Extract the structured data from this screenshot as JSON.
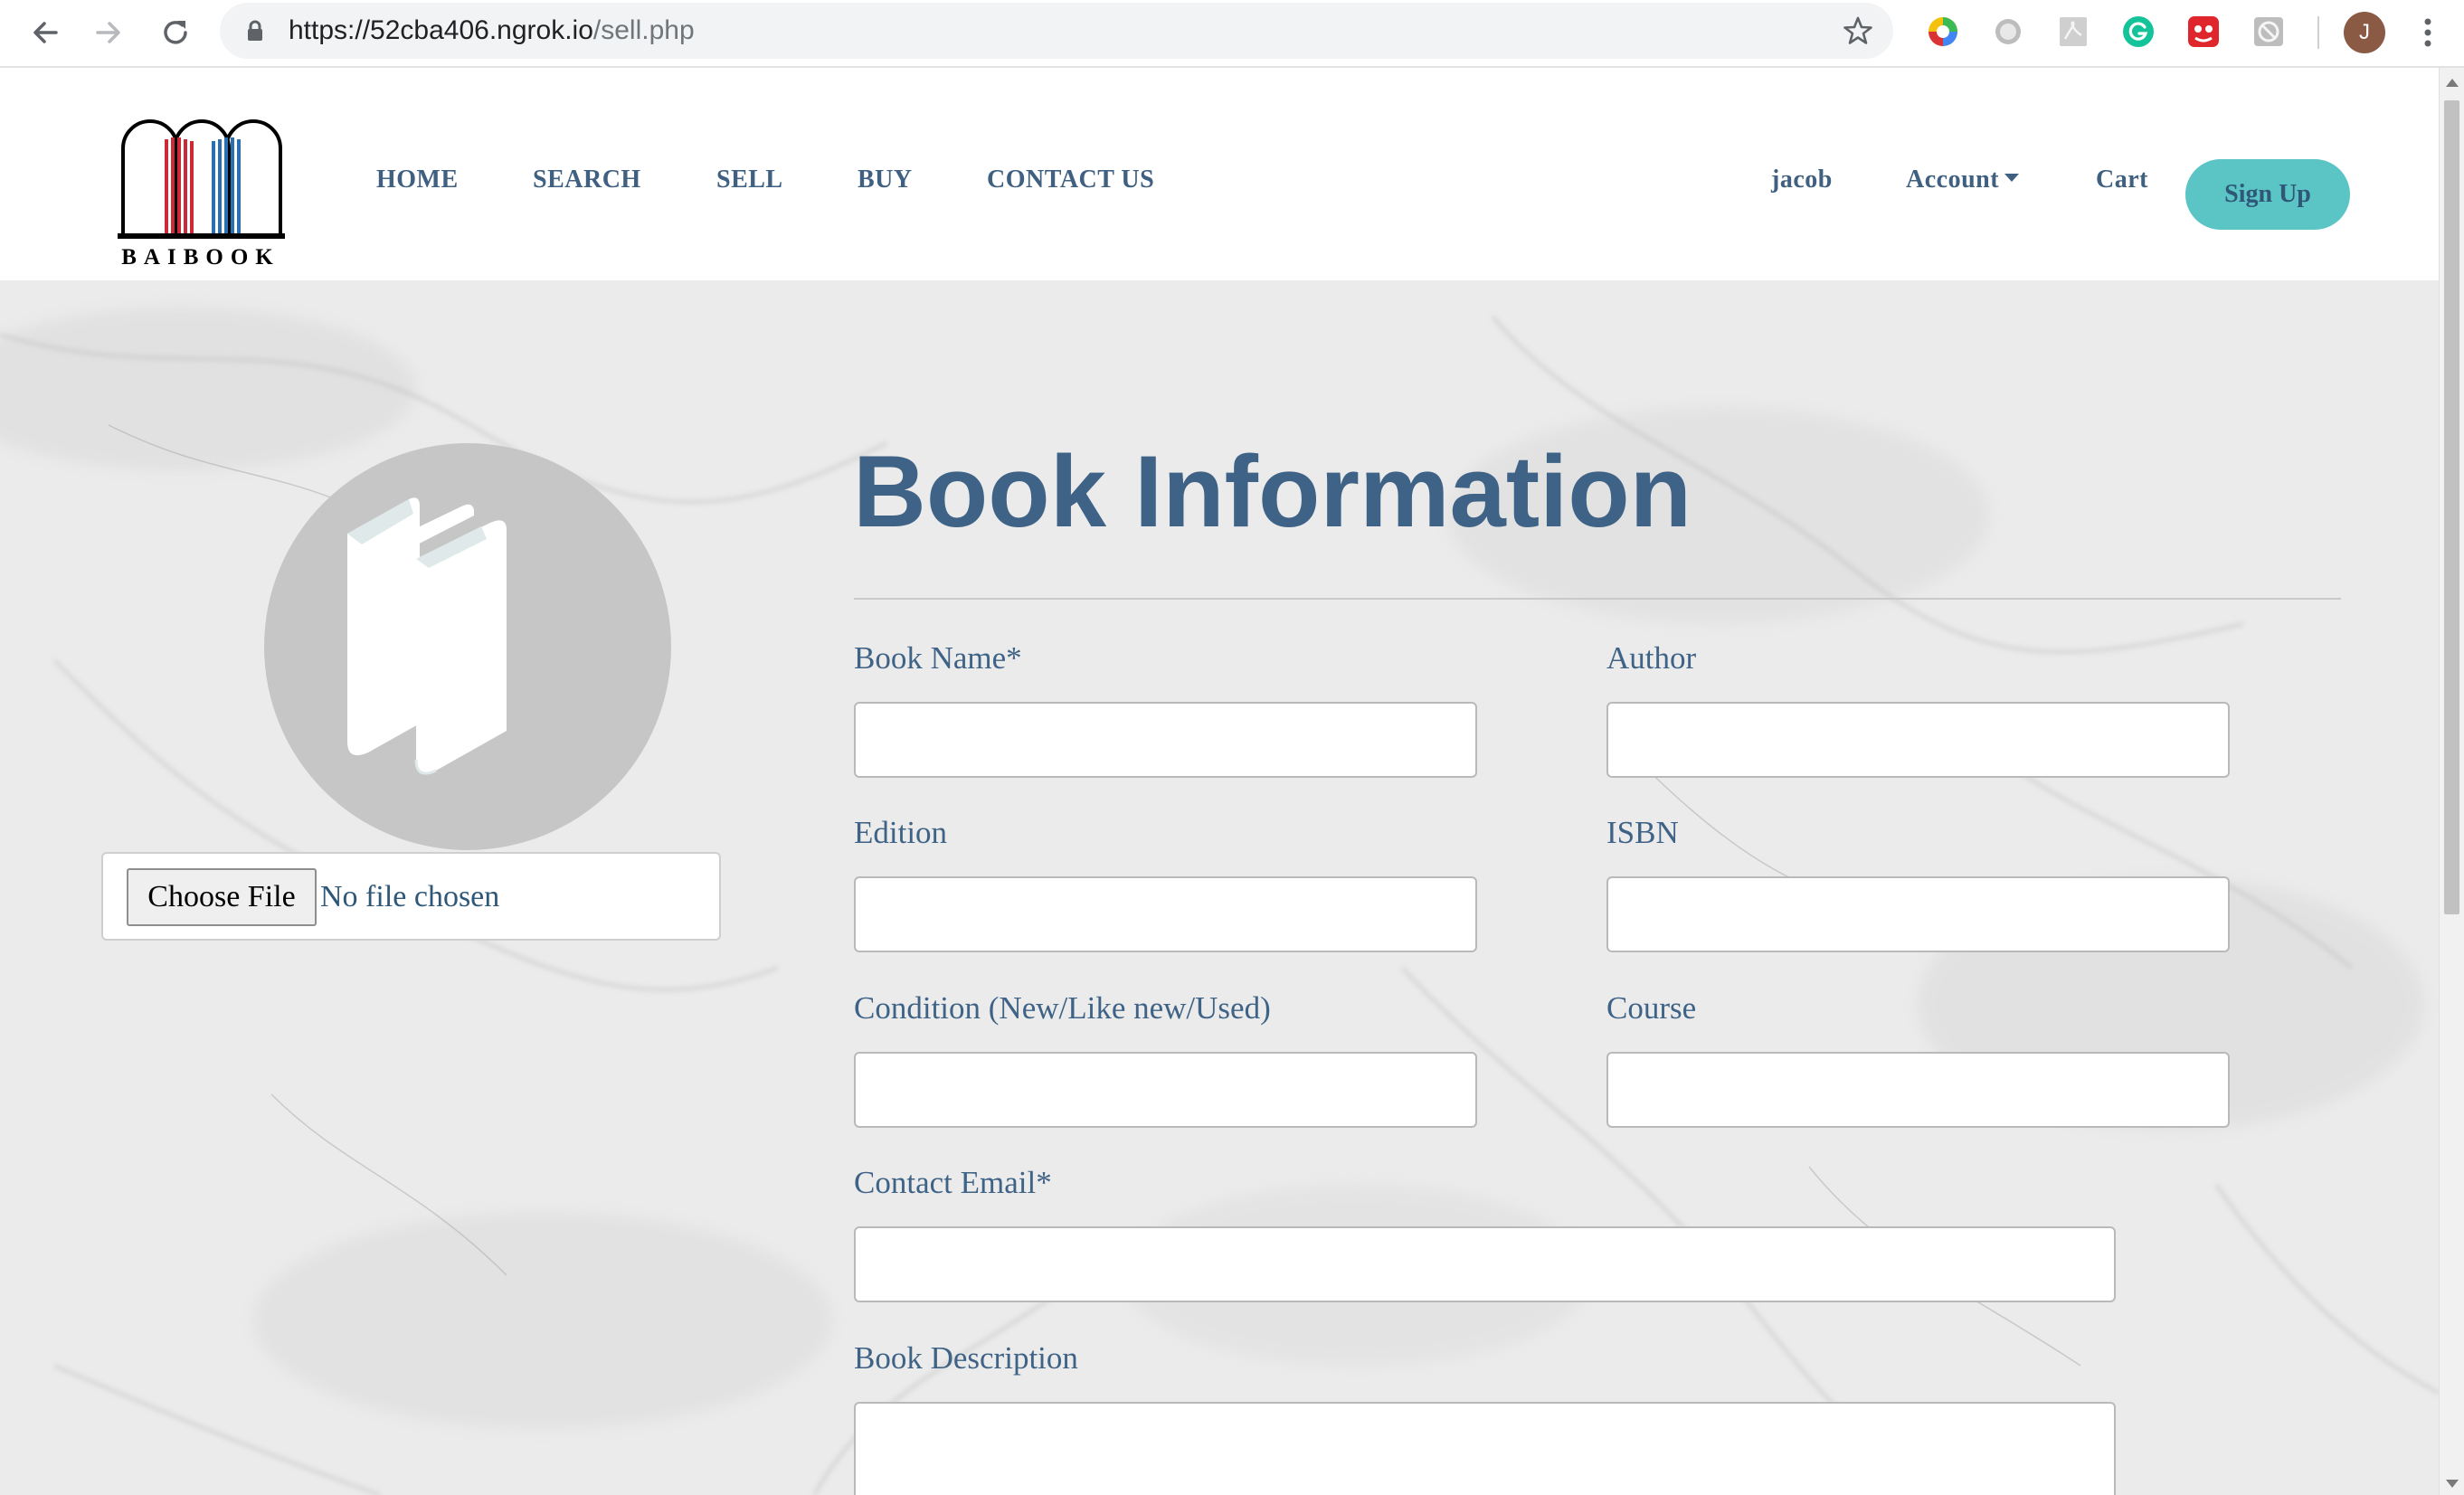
{
  "browser": {
    "url_host": "https://52cba406.ngrok.io",
    "url_path": "/sell.php",
    "avatar_letter": "J",
    "extensions": [
      "color-wheel-extension-icon",
      "circle-extension-icon",
      "pdf-extension-icon",
      "grammarly-extension-icon",
      "red-extension-icon",
      "grey-block-extension-icon"
    ]
  },
  "header": {
    "logo_text": "BAIBOOK",
    "nav": {
      "home": "HOME",
      "search": "SEARCH",
      "sell": "SELL",
      "buy": "BUY",
      "contact": "CONTACT US"
    },
    "user": {
      "username": "jacob",
      "account": "Account",
      "cart": "Cart",
      "signup": "Sign Up"
    }
  },
  "image_upload": {
    "button_label": "Choose File",
    "status": "No file chosen"
  },
  "form": {
    "title": "Book Information",
    "fields": {
      "book_name": {
        "label": "Book Name*",
        "value": ""
      },
      "author": {
        "label": "Author",
        "value": ""
      },
      "edition": {
        "label": "Edition",
        "value": ""
      },
      "isbn": {
        "label": "ISBN",
        "value": ""
      },
      "condition": {
        "label": "Condition (New/Like new/Used)",
        "value": ""
      },
      "course": {
        "label": "Course",
        "value": ""
      },
      "contact_email": {
        "label": "Contact Email*",
        "value": ""
      },
      "description": {
        "label": "Book Description",
        "value": ""
      }
    }
  },
  "colors": {
    "brand_blue": "#3f6386",
    "signup_teal": "#5bc4c4",
    "logo_red": "#cc2a36",
    "logo_blue": "#2a6fb0"
  }
}
